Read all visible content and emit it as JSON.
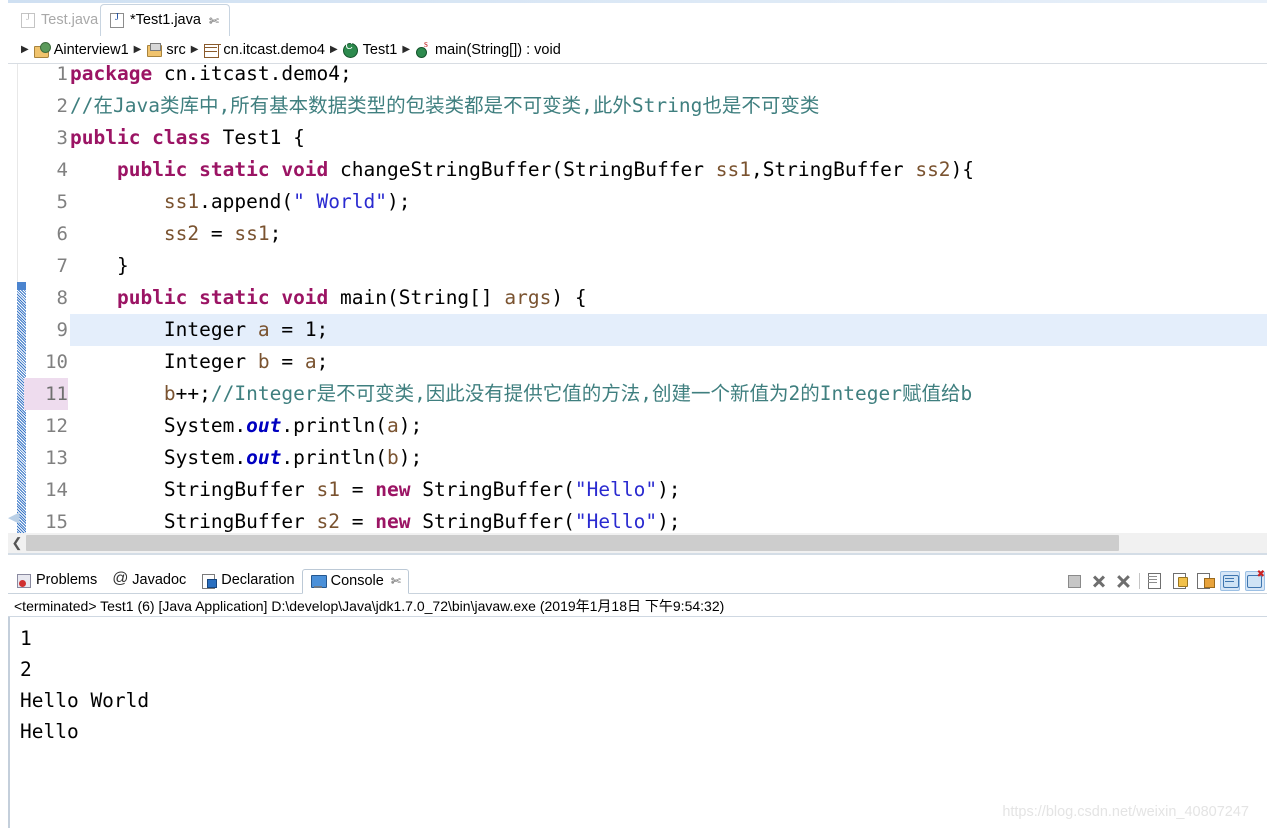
{
  "editor_tabs": [
    {
      "label": "Test.java",
      "active": false,
      "dirty": false,
      "icon": "java-file-icon"
    },
    {
      "label": "*Test1.java",
      "active": true,
      "dirty": true,
      "icon": "java-file-icon",
      "close": "✄"
    }
  ],
  "breadcrumb": {
    "separator": "▶",
    "items": [
      {
        "label": "Ainterview1",
        "icon": "java-project-icon"
      },
      {
        "label": "src",
        "icon": "source-folder-icon"
      },
      {
        "label": "cn.itcast.demo4",
        "icon": "package-icon"
      },
      {
        "label": "Test1",
        "icon": "class-icon"
      },
      {
        "label": "main(String[]) : void",
        "icon": "method-static-icon"
      }
    ]
  },
  "code": {
    "first_visible_line": 1,
    "highlighted_line": 9,
    "marked_gutter_line": 11,
    "lines": [
      {
        "n": 1,
        "clipped": true,
        "tokens": [
          {
            "t": "package",
            "c": "kw"
          },
          {
            "t": " cn.itcast.demo4;",
            "c": ""
          }
        ]
      },
      {
        "n": 2,
        "tokens": [
          {
            "t": "//在Java类库中,所有基本数据类型的包装类都是不可变类,此外String也是不可变类",
            "c": "cmt"
          }
        ]
      },
      {
        "n": 3,
        "tokens": [
          {
            "t": "public class",
            "c": "kw"
          },
          {
            "t": " Test1 {",
            "c": ""
          }
        ]
      },
      {
        "n": 4,
        "tokens": [
          {
            "t": "    ",
            "c": ""
          },
          {
            "t": "public static void",
            "c": "kw"
          },
          {
            "t": " changeStringBuffer(StringBuffer ",
            "c": ""
          },
          {
            "t": "ss1",
            "c": "par"
          },
          {
            "t": ",StringBuffer ",
            "c": ""
          },
          {
            "t": "ss2",
            "c": "par"
          },
          {
            "t": "){",
            "c": ""
          }
        ]
      },
      {
        "n": 5,
        "tokens": [
          {
            "t": "        ",
            "c": ""
          },
          {
            "t": "ss1",
            "c": "par"
          },
          {
            "t": ".append(",
            "c": ""
          },
          {
            "t": "\" World\"",
            "c": "str"
          },
          {
            "t": ");",
            "c": ""
          }
        ]
      },
      {
        "n": 6,
        "tokens": [
          {
            "t": "        ",
            "c": ""
          },
          {
            "t": "ss2",
            "c": "par"
          },
          {
            "t": " = ",
            "c": ""
          },
          {
            "t": "ss1",
            "c": "par"
          },
          {
            "t": ";",
            "c": ""
          }
        ]
      },
      {
        "n": 7,
        "tokens": [
          {
            "t": "    }",
            "c": ""
          }
        ]
      },
      {
        "n": 8,
        "tokens": [
          {
            "t": "    ",
            "c": ""
          },
          {
            "t": "public static void",
            "c": "kw"
          },
          {
            "t": " main(String[] ",
            "c": ""
          },
          {
            "t": "args",
            "c": "par"
          },
          {
            "t": ") {",
            "c": ""
          }
        ]
      },
      {
        "n": 9,
        "tokens": [
          {
            "t": "        Integer ",
            "c": ""
          },
          {
            "t": "a",
            "c": "par"
          },
          {
            "t": " = 1;",
            "c": ""
          }
        ]
      },
      {
        "n": 10,
        "tokens": [
          {
            "t": "        Integer ",
            "c": ""
          },
          {
            "t": "b",
            "c": "par"
          },
          {
            "t": " = ",
            "c": ""
          },
          {
            "t": "a",
            "c": "par"
          },
          {
            "t": ";",
            "c": ""
          }
        ]
      },
      {
        "n": 11,
        "tokens": [
          {
            "t": "        ",
            "c": ""
          },
          {
            "t": "b",
            "c": "par"
          },
          {
            "t": "++;",
            "c": ""
          },
          {
            "t": "//Integer是不可变类,因此没有提供它值的方法,创建一个新值为2的Integer赋值给b",
            "c": "cmt"
          }
        ]
      },
      {
        "n": 12,
        "tokens": [
          {
            "t": "        System.",
            "c": ""
          },
          {
            "t": "out",
            "c": "fld"
          },
          {
            "t": ".println(",
            "c": ""
          },
          {
            "t": "a",
            "c": "par"
          },
          {
            "t": ");",
            "c": ""
          }
        ]
      },
      {
        "n": 13,
        "tokens": [
          {
            "t": "        System.",
            "c": ""
          },
          {
            "t": "out",
            "c": "fld"
          },
          {
            "t": ".println(",
            "c": ""
          },
          {
            "t": "b",
            "c": "par"
          },
          {
            "t": ");",
            "c": ""
          }
        ]
      },
      {
        "n": 14,
        "tokens": [
          {
            "t": "        StringBuffer ",
            "c": ""
          },
          {
            "t": "s1",
            "c": "par"
          },
          {
            "t": " = ",
            "c": ""
          },
          {
            "t": "new",
            "c": "kw"
          },
          {
            "t": " StringBuffer(",
            "c": ""
          },
          {
            "t": "\"Hello\"",
            "c": "str"
          },
          {
            "t": ");",
            "c": ""
          }
        ]
      },
      {
        "n": 15,
        "tokens": [
          {
            "t": "        StringBuffer ",
            "c": ""
          },
          {
            "t": "s2",
            "c": "par"
          },
          {
            "t": " = ",
            "c": ""
          },
          {
            "t": "new",
            "c": "kw"
          },
          {
            "t": " StringBuffer(",
            "c": ""
          },
          {
            "t": "\"Hello\"",
            "c": "str"
          },
          {
            "t": ");",
            "c": ""
          }
        ]
      }
    ]
  },
  "editor_scrollbar": {
    "arrow_left": "❮"
  },
  "console_panel": {
    "tabs": [
      {
        "label": "Problems",
        "icon": "problems-icon",
        "active": false
      },
      {
        "label": "Javadoc",
        "icon": "javadoc-icon",
        "active": false
      },
      {
        "label": "Declaration",
        "icon": "declaration-icon",
        "active": false
      },
      {
        "label": "Console",
        "icon": "console-icon",
        "active": true,
        "close": "✄"
      }
    ],
    "toolbar": [
      {
        "name": "terminate-button",
        "icon": "stop-square-icon",
        "selected": false
      },
      {
        "name": "remove-launch-button",
        "icon": "x-icon",
        "selected": false
      },
      {
        "name": "remove-all-terminated-button",
        "icon": "double-x-icon",
        "selected": false
      },
      {
        "name": "clear-console-button",
        "icon": "clear-document-icon",
        "selected": false
      },
      {
        "name": "scroll-lock-button",
        "icon": "lock-icon",
        "selected": false
      },
      {
        "name": "pin-console-button",
        "icon": "pin-paste-icon",
        "selected": false
      },
      {
        "name": "display-selected-console-button",
        "icon": "console-screen-icon",
        "selected": true
      },
      {
        "name": "open-console-button",
        "icon": "console-screen-red-icon",
        "selected": true
      }
    ],
    "status": "<terminated> Test1 (6) [Java Application] D:\\develop\\Java\\jdk1.7.0_72\\bin\\javaw.exe (2019年1月18日 下午9:54:32)",
    "output": [
      "1",
      "2",
      "Hello World",
      "Hello"
    ]
  },
  "watermark": "https://blog.csdn.net/weixin_40807247",
  "colors": {
    "keyword": "#9b1464",
    "string": "#2a2ad0",
    "comment": "#3f7f7f",
    "field": "#0000c0",
    "parameter": "#7a5330",
    "line_highlight": "#e4eefb",
    "gutter_mark": "#eedcee",
    "change_bar": "#3b78c8"
  }
}
